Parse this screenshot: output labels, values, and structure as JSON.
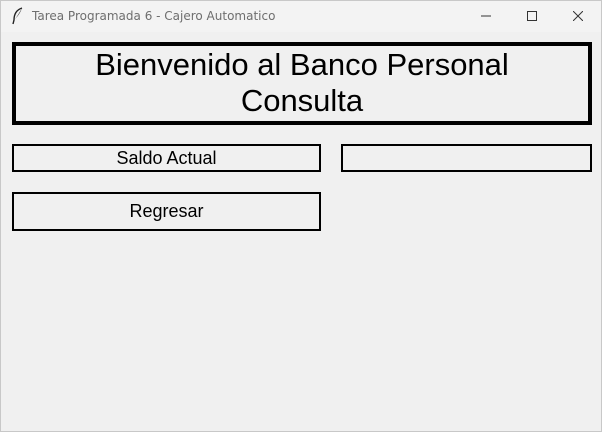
{
  "window": {
    "title": "Tarea Programada 6 - Cajero Automatico"
  },
  "header": {
    "line1": "Bienvenido al Banco Personal",
    "line2": "Consulta"
  },
  "actions": {
    "saldo_label": "Saldo Actual",
    "saldo_value": "",
    "regresar_label": "Regresar"
  },
  "icons": {
    "app": "feather-icon",
    "minimize": "minimize-icon",
    "maximize": "maximize-icon",
    "close": "close-icon"
  },
  "colors": {
    "background": "#f0f0f0",
    "border": "#000000",
    "title_text": "#6e6e6e"
  }
}
